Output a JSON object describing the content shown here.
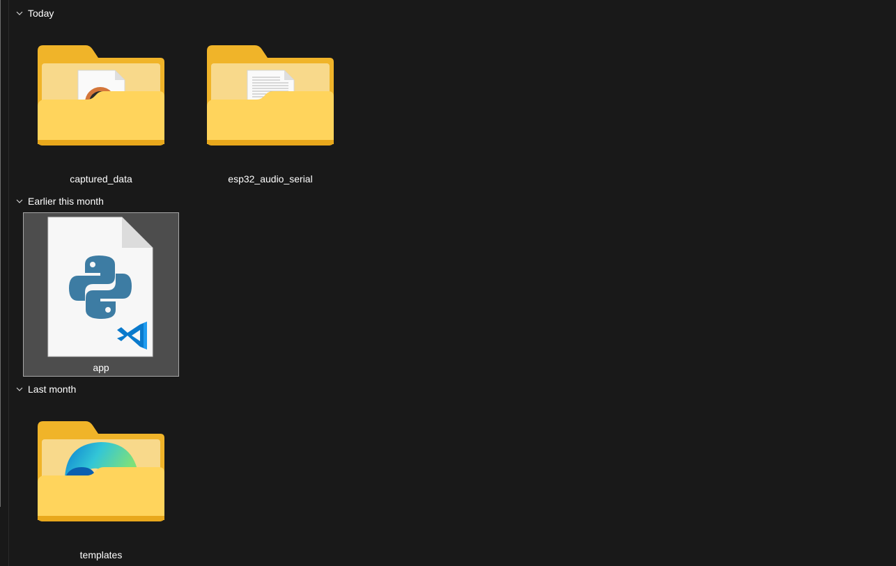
{
  "groups": [
    {
      "label": "Today",
      "items": [
        {
          "name": "captured_data",
          "type": "folder",
          "preview": "media-file-icon"
        },
        {
          "name": "esp32_audio_serial",
          "type": "folder",
          "preview": "text-document-icon"
        }
      ]
    },
    {
      "label": "Earlier this month",
      "items": [
        {
          "name": "app",
          "type": "python-file",
          "selected": true,
          "preview": "python-vscode-icon"
        }
      ]
    },
    {
      "label": "Last month",
      "items": [
        {
          "name": "templates",
          "type": "folder",
          "preview": "edge-browser-icon"
        }
      ]
    }
  ],
  "colors": {
    "background": "#191919",
    "selection_fill": "#4d4d4d",
    "selection_border": "#a8a8a8",
    "folder_back": "#f0b429",
    "folder_front": "#ffd45c",
    "python_blue": "#3d7ca3",
    "vscode_blue": "#0a7acc"
  }
}
